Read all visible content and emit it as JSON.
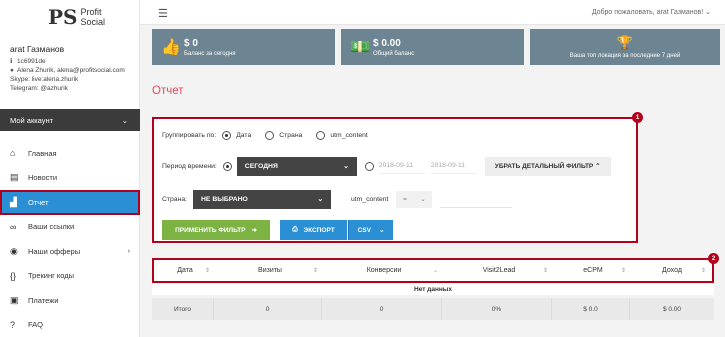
{
  "brand": {
    "mark": "PS",
    "line1": "Profit",
    "line2": "Social"
  },
  "topbar": {
    "welcome": "Добро пожаловать, arat Газманов! ⌄"
  },
  "user": {
    "name": "arat Газманов",
    "id": "1c6991de",
    "contact": "Alena Zhurik, alena@profitsocial.com",
    "skype": "Skype: live:alena.zhurik",
    "telegram": "Telegram: @azhurik"
  },
  "account_menu": {
    "label": "Мой аккаунт"
  },
  "nav": [
    {
      "label": "Главная",
      "icon": "home-icon"
    },
    {
      "label": "Новости",
      "icon": "news-icon"
    },
    {
      "label": "Отчет",
      "icon": "chart-icon",
      "active": true
    },
    {
      "label": "Ваши ссылки",
      "icon": "link-icon"
    },
    {
      "label": "Наши офферы",
      "icon": "offers-icon"
    },
    {
      "label": "Трекинг коды",
      "icon": "code-icon"
    },
    {
      "label": "Платежи",
      "icon": "wallet-icon"
    },
    {
      "label": "FAQ",
      "icon": "help-icon"
    }
  ],
  "stats": [
    {
      "value": "$ 0",
      "label": "Баланс за сегодня",
      "icon": "thumbs-up-icon"
    },
    {
      "value": "$ 0.00",
      "label": "Общий баланс",
      "icon": "money-icon"
    },
    {
      "value": "",
      "label": "Ваша топ локация за последние 7 дней",
      "icon": "trophy-icon"
    }
  ],
  "page": {
    "title": "Отчет"
  },
  "filter": {
    "badge": "1",
    "group_label": "Группировать по:",
    "group_options": [
      "Дата",
      "Страна",
      "utm_content"
    ],
    "group_selected": "Дата",
    "period_label": "Период времени:",
    "period_value": "СЕГОДНЯ",
    "date_from": "2018-09-11",
    "date_to": "2018-09-11",
    "remove_detail_filter": "УБРАТЬ ДЕТАЛЬНЫЙ ФИЛЬТР ⌃",
    "country_label": "Страна:",
    "country_value": "НЕ ВЫБРАНО",
    "utm_label": "utm_content",
    "utm_operator": "=",
    "apply_button": "ПРИМЕНИТЬ ФИЛЬТР",
    "export_button": "ЭКСПОРТ",
    "csv_button": "CSV"
  },
  "table": {
    "badge": "2",
    "columns": [
      "Дата",
      "Визиты",
      "Конверсии",
      "Visit2Lead",
      "eCPM",
      "Доход"
    ],
    "empty_text": "Нет данных",
    "totals": [
      "Итого",
      "0",
      "0",
      "0%",
      "$ 0.0",
      "$ 0.00"
    ]
  },
  "colors": {
    "accent": "#2b8fd6",
    "title": "#e8495e",
    "highlight": "#b3001b",
    "card": "#6d8592",
    "apply": "#7cb342"
  }
}
